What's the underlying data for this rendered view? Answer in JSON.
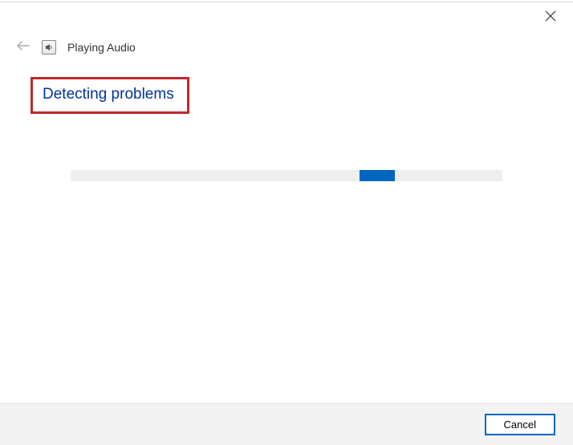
{
  "header": {
    "title": "Playing Audio"
  },
  "main": {
    "heading": "Detecting problems"
  },
  "footer": {
    "cancel_label": "Cancel"
  },
  "icons": {
    "close": "close-icon",
    "back": "back-arrow-icon",
    "audio": "audio-icon"
  },
  "colors": {
    "accent": "#0067c0",
    "heading": "#003399",
    "highlight_border": "#c1272d"
  }
}
